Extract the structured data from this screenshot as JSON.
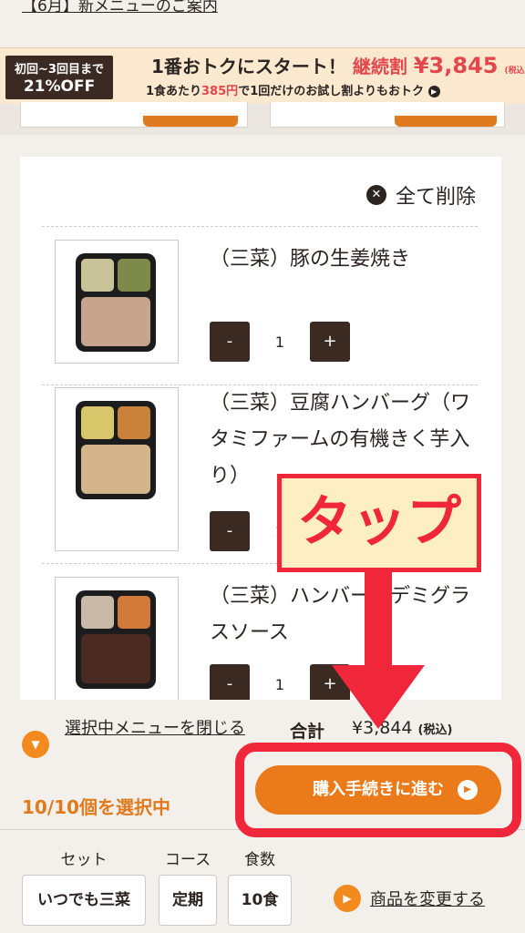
{
  "top_link": "【6月】新メニューのご案内",
  "banner": {
    "badge_line1": "初回~3回目まで",
    "badge_line2": "21%OFF",
    "headline_start": "1番おトクにスタート！",
    "headline_discount": "継続割",
    "headline_price": "¥3,845",
    "headline_tax": "(税込)",
    "sub_prefix": "1食あたり",
    "sub_amount": "385円",
    "sub_suffix": "で1回だけのお試し割よりもおトク"
  },
  "cart": {
    "delete_all_label": "全て削除",
    "items": [
      {
        "name": "（三菜）豚の生姜焼き",
        "qty": "1",
        "colors": [
          "#c9c39a",
          "#7d8a4a",
          "#c6a58c"
        ]
      },
      {
        "name": "（三菜）豆腐ハンバーグ（ワタミファームの有機きく芋入り）",
        "qty": "1",
        "colors": [
          "#d8c66a",
          "#c9823a",
          "#d4b48a"
        ]
      },
      {
        "name": "（三菜）ハンバーグデミグラスソース",
        "qty": "1",
        "colors": [
          "#c9b9a8",
          "#d27a3a",
          "#4a2a22"
        ]
      }
    ],
    "minus_label": "-",
    "plus_label": "+"
  },
  "summary": {
    "close_menu_label": "選択中メニューを閉じる",
    "total_label": "合計",
    "total_value": "¥3,844",
    "total_tax": "(税込)",
    "selected_count": "10/10個を選択中",
    "proceed_label": "購入手続きに進む"
  },
  "options": {
    "set_label": "セット",
    "set_value": "いつでも三菜",
    "course_label": "コース",
    "course_value": "定期",
    "count_label": "食数",
    "count_value": "10食",
    "change_label": "商品を変更する"
  },
  "annotation": {
    "tap_label": "タップ",
    "accent_color": "#f0263b"
  },
  "colors": {
    "brand_orange": "#ea7a1a",
    "dark_brown": "#3a2a22"
  }
}
